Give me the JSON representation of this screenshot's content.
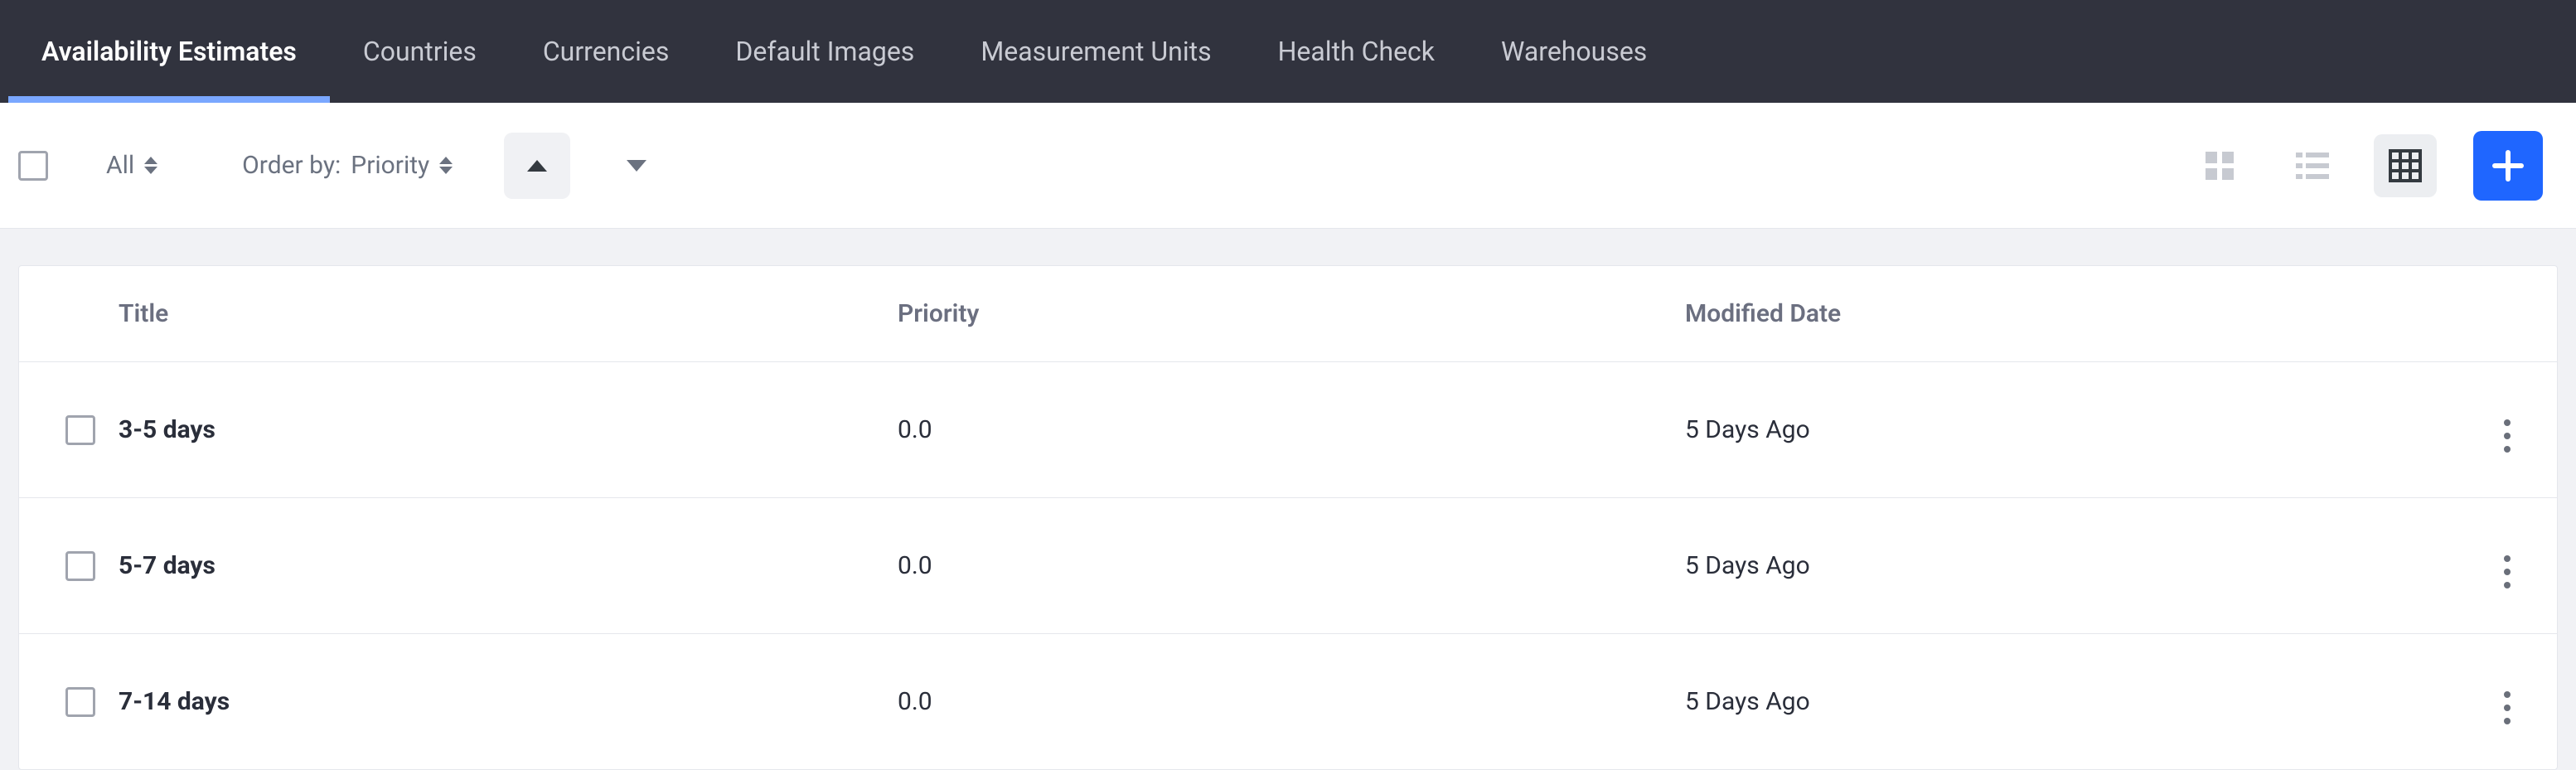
{
  "nav": {
    "tabs": [
      {
        "label": "Availability Estimates",
        "active": true
      },
      {
        "label": "Countries",
        "active": false
      },
      {
        "label": "Currencies",
        "active": false
      },
      {
        "label": "Default Images",
        "active": false
      },
      {
        "label": "Measurement Units",
        "active": false
      },
      {
        "label": "Health Check",
        "active": false
      },
      {
        "label": "Warehouses",
        "active": false
      }
    ]
  },
  "toolbar": {
    "filter_label": "All",
    "order_prefix": "Order by:",
    "order_field": "Priority",
    "sort_direction": "asc",
    "view_mode": "table"
  },
  "table": {
    "columns": {
      "title": "Title",
      "priority": "Priority",
      "modified": "Modified Date"
    },
    "rows": [
      {
        "title": "3-5 days",
        "priority": "0.0",
        "modified": "5 Days Ago"
      },
      {
        "title": "5-7 days",
        "priority": "0.0",
        "modified": "5 Days Ago"
      },
      {
        "title": "7-14 days",
        "priority": "0.0",
        "modified": "5 Days Ago"
      }
    ]
  }
}
